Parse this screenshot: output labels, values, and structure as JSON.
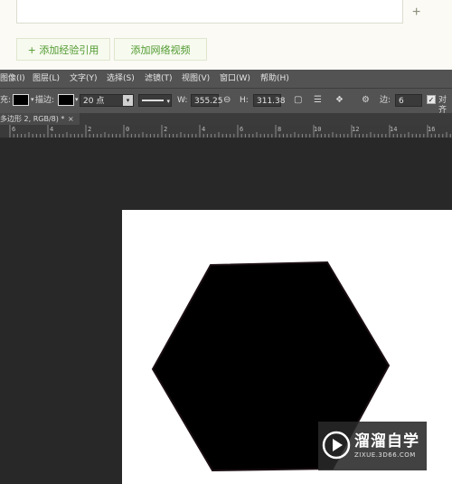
{
  "web": {
    "add_button_icon": "plus-icon",
    "buttons": {
      "add_reference": "+ 添加经验引用",
      "add_video": "添加网络视频"
    }
  },
  "menubar": [
    "图像(I)",
    "图层(L)",
    "文字(Y)",
    "选择(S)",
    "滤镜(T)",
    "视图(V)",
    "窗口(W)",
    "帮助(H)"
  ],
  "options": {
    "fill_label": "充:",
    "stroke_label": "描边:",
    "stroke_width": "20 点",
    "w_label": "W:",
    "w_value": "355.25",
    "h_label": "H:",
    "h_value": "311.38",
    "sides_label": "边:",
    "sides_value": "6",
    "align_label": "对齐"
  },
  "document_tab": {
    "title": "多边形 2, RGB/8) *",
    "close": "×"
  },
  "ruler_labels": [
    "6",
    "4",
    "2",
    "0",
    "2",
    "4",
    "6",
    "8",
    "10",
    "12",
    "14",
    "16"
  ],
  "watermark": {
    "title": "溜溜自学",
    "url": "ZIXUE.3D66.COM"
  },
  "colors": {
    "brand_green": "#4f9a2f",
    "ps_panel": "#535353",
    "workspace": "#282828",
    "hexagon_fill": "#000000"
  }
}
